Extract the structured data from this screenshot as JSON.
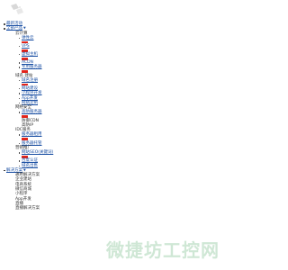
{
  "nav": {
    "latest": "最新活动",
    "products": "全部产品",
    "solutions": "解决方案"
  },
  "groups": [
    {
      "title": "云计算",
      "items": [
        {
          "label": "弹性云",
          "badge": true
        },
        {
          "label": "VPS",
          "badge": true
        },
        {
          "label": "虚拟主机",
          "badge": true
        },
        {
          "label": "ACDN",
          "badge": false
        },
        {
          "label": "专用服务器",
          "badge": true
        }
      ]
    },
    {
      "title": "域名 建站",
      "items": [
        {
          "label": "域名注册",
          "badge": true
        },
        {
          "label": "网站建设",
          "badge": false
        },
        {
          "label": "小程序开发",
          "badge": false
        },
        {
          "label": "App开发",
          "badge": false
        },
        {
          "label": "网站定制",
          "badge": false
        }
      ]
    },
    {
      "title": "网络安全",
      "items": [
        {
          "label": "高防服务器",
          "badge": true
        },
        {
          "label": "防御CDN",
          "badge": false,
          "plain": true
        },
        {
          "label": "高防IP",
          "badge": false,
          "plain": true
        }
      ]
    },
    {
      "title": "IDC服务",
      "items": [
        {
          "label": "服务器租用",
          "badge": true
        },
        {
          "label": "服务器托管",
          "badge": false
        }
      ]
    },
    {
      "title": "营销推广",
      "items": [
        {
          "label": "网站SEO(关键词)",
          "badge": true
        },
        {
          "label": "百度认证",
          "badge": false
        },
        {
          "label": "域名出售",
          "badge": false
        }
      ]
    }
  ],
  "solutions": [
    "通用解决方案",
    "企业建站",
    "电商系统",
    "微信商城",
    "小程序",
    "App开发",
    "直播",
    "直播解决方案"
  ],
  "watermark": "微捷坊工控网",
  "colors": {
    "link": "#1a4fa3",
    "badge": "#e2231a",
    "watermark": "#cfe7d5"
  }
}
